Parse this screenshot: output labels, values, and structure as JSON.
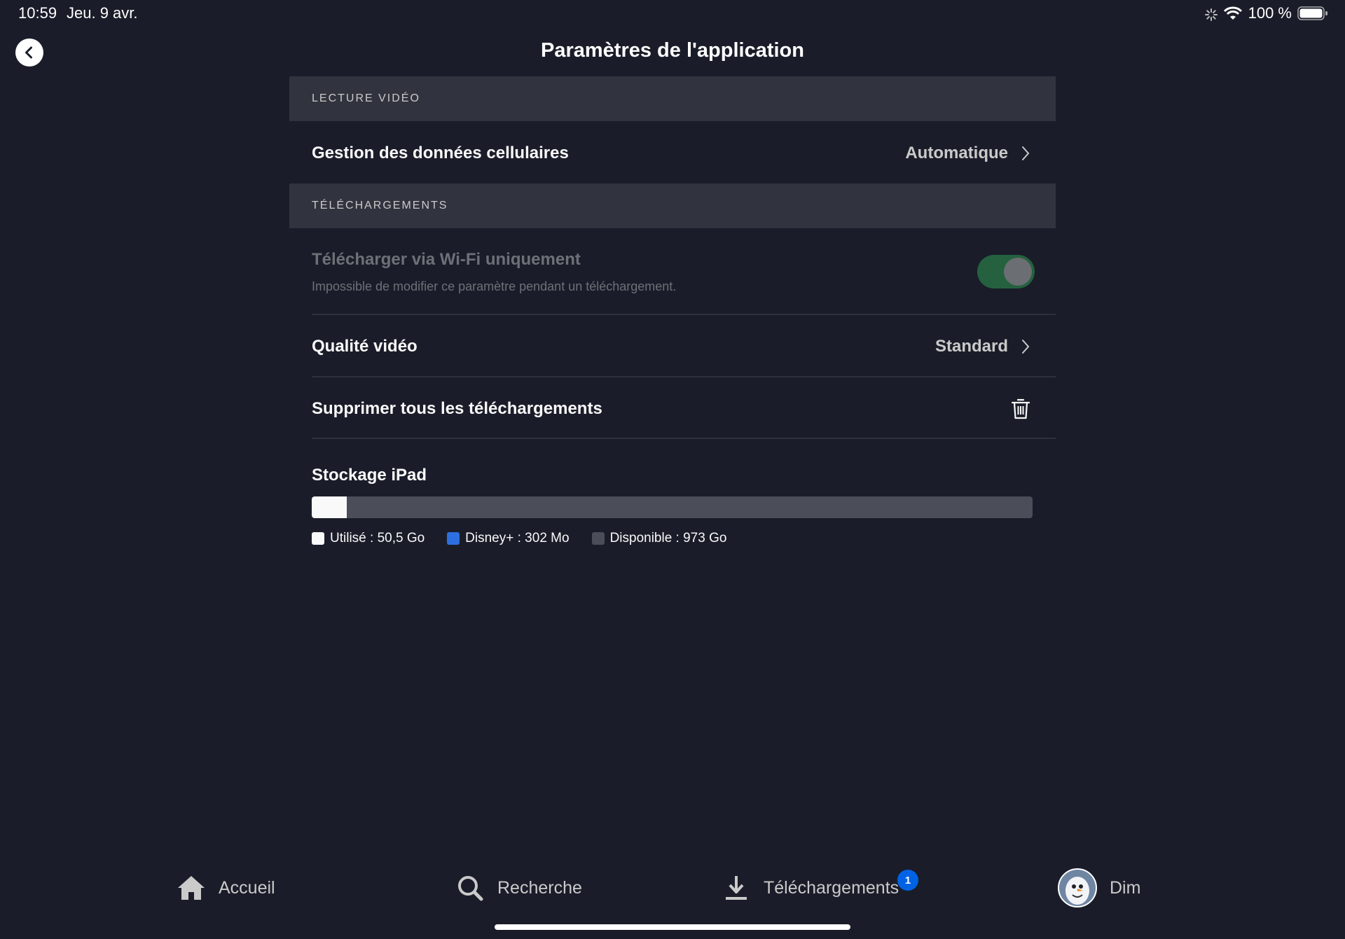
{
  "status_bar": {
    "time": "10:59",
    "date": "Jeu. 9 avr.",
    "battery": "100 %"
  },
  "header": {
    "title": "Paramètres de l'application"
  },
  "sections": {
    "video": {
      "header": "LECTURE VIDÉO",
      "cellular_label": "Gestion des données cellulaires",
      "cellular_value": "Automatique"
    },
    "downloads": {
      "header": "TÉLÉCHARGEMENTS",
      "wifi_label": "Télécharger via Wi-Fi uniquement",
      "wifi_sublabel": "Impossible de modifier ce paramètre pendant un téléchargement.",
      "wifi_enabled": true,
      "quality_label": "Qualité vidéo",
      "quality_value": "Standard",
      "delete_label": "Supprimer tous les téléchargements"
    }
  },
  "storage": {
    "title": "Stockage iPad",
    "used_fraction": 0.049,
    "legend": {
      "used": "Utilisé : 50,5 Go",
      "disney": "Disney+ : 302 Mo",
      "available": "Disponible : 973 Go"
    },
    "colors": {
      "used": "#f9f9f9",
      "disney": "#2d6fe0",
      "available": "#4b4e59"
    }
  },
  "tabbar": {
    "home": "Accueil",
    "search": "Recherche",
    "downloads": "Téléchargements",
    "downloads_badge": "1",
    "profile": "Dim"
  },
  "colors": {
    "background": "#1a1d29",
    "section_header": "#31343e",
    "toggle_on": "#25613f",
    "badge": "#0063e5"
  }
}
